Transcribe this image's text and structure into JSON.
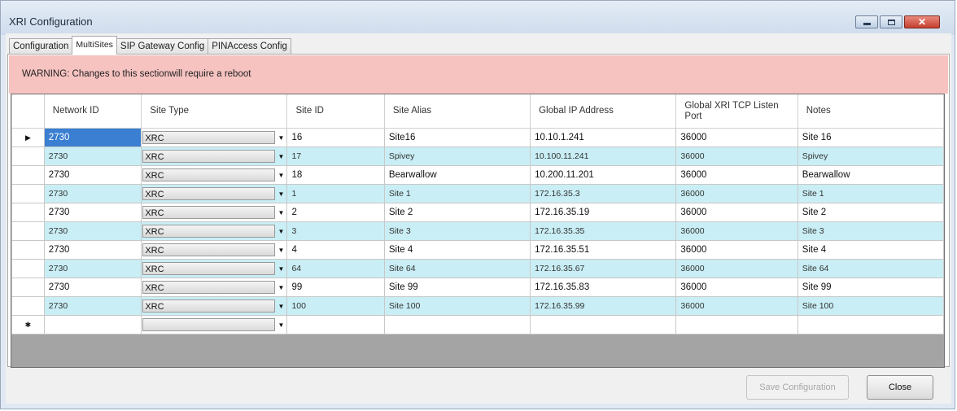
{
  "window": {
    "title": "XRI Configuration"
  },
  "tabs": [
    {
      "label": "Configuration"
    },
    {
      "label": "MultiSites"
    },
    {
      "label": "SIP Gateway Config"
    },
    {
      "label": "PINAccess Config"
    }
  ],
  "active_tab": "MultiSites",
  "warning": {
    "text": "WARNING: Changes to this sectionwill require a reboot"
  },
  "grid": {
    "columns": [
      "Network ID",
      "Site Type",
      "Site ID",
      "Site Alias",
      "Global IP Address",
      "Global XRI TCP Listen Port",
      "Notes"
    ],
    "rows": [
      {
        "indicator": "▶",
        "network_id": "2730",
        "site_type": "XRC",
        "site_id": "16",
        "site_alias": "Site16",
        "global_ip": "10.10.1.241",
        "port": "36000",
        "notes": "Site 16"
      },
      {
        "indicator": "",
        "network_id": "2730",
        "site_type": "XRC",
        "site_id": "17",
        "site_alias": "Spivey",
        "global_ip": "10.100.11.241",
        "port": "36000",
        "notes": "Spivey"
      },
      {
        "indicator": "",
        "network_id": "2730",
        "site_type": "XRC",
        "site_id": "18",
        "site_alias": "Bearwallow",
        "global_ip": "10.200.11.201",
        "port": "36000",
        "notes": "Bearwallow"
      },
      {
        "indicator": "",
        "network_id": "2730",
        "site_type": "XRC",
        "site_id": "1",
        "site_alias": "Site 1",
        "global_ip": "172.16.35.3",
        "port": "36000",
        "notes": "Site 1"
      },
      {
        "indicator": "",
        "network_id": "2730",
        "site_type": "XRC",
        "site_id": "2",
        "site_alias": "Site 2",
        "global_ip": "172.16.35.19",
        "port": "36000",
        "notes": "Site 2"
      },
      {
        "indicator": "",
        "network_id": "2730",
        "site_type": "XRC",
        "site_id": "3",
        "site_alias": "Site 3",
        "global_ip": "172.16.35.35",
        "port": "36000",
        "notes": "Site 3"
      },
      {
        "indicator": "",
        "network_id": "2730",
        "site_type": "XRC",
        "site_id": "4",
        "site_alias": "Site 4",
        "global_ip": "172.16.35.51",
        "port": "36000",
        "notes": "Site 4"
      },
      {
        "indicator": "",
        "network_id": "2730",
        "site_type": "XRC",
        "site_id": "64",
        "site_alias": "Site 64",
        "global_ip": "172.16.35.67",
        "port": "36000",
        "notes": "Site 64"
      },
      {
        "indicator": "",
        "network_id": "2730",
        "site_type": "XRC",
        "site_id": "99",
        "site_alias": "Site 99",
        "global_ip": "172.16.35.83",
        "port": "36000",
        "notes": "Site 99"
      },
      {
        "indicator": "",
        "network_id": "2730",
        "site_type": "XRC",
        "site_id": "100",
        "site_alias": "Site 100",
        "global_ip": "172.16.35.99",
        "port": "36000",
        "notes": "Site 100"
      }
    ],
    "new_row_indicator": "✱"
  },
  "buttons": {
    "save": "Save Configuration",
    "close": "Close"
  },
  "colors": {
    "warning_bg": "#f6c3c1",
    "alt_row": "#c9eef5",
    "selection": "#3a7fd1"
  },
  "icons": {
    "minimize": "minimize-icon",
    "maximize": "maximize-icon",
    "close": "close-icon",
    "dropdown": "dropdown-arrow-icon",
    "row_pointer": "row-pointer-icon",
    "new_row": "new-row-icon"
  }
}
